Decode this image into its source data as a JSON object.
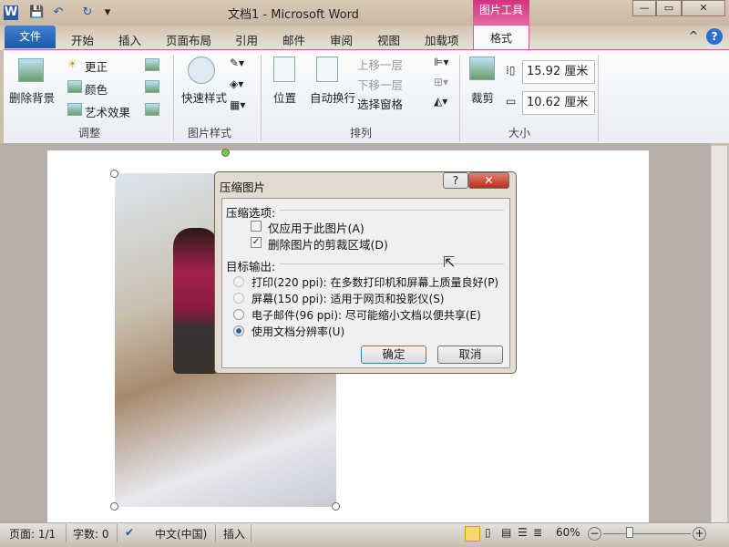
{
  "window": {
    "title": "文档1  -  Microsoft Word",
    "context_tab": "图片工具",
    "minimize": "—",
    "restore": "▭",
    "close": "✕"
  },
  "quick_access": {
    "word": "W",
    "save": "💾",
    "undo": "↶",
    "redo": "↻",
    "customize": "▾"
  },
  "tabs": {
    "file": "文件",
    "items": [
      "开始",
      "插入",
      "页面布局",
      "引用",
      "邮件",
      "审阅",
      "视图",
      "加载项"
    ],
    "format": "格式",
    "collapse": "^",
    "help": "?"
  },
  "ribbon": {
    "adjust": {
      "label": "调整",
      "remove_bg": "删除背景",
      "corrections": "更正",
      "color": "颜色",
      "artistic": "艺术效果"
    },
    "styles": {
      "label": "图片样式",
      "quick_styles": "快速样式"
    },
    "arrange": {
      "label": "排列",
      "position": "位置",
      "wrap": "自动换行",
      "bring_forward": "上移一层",
      "send_backward": "下移一层",
      "selection_pane": "选择窗格"
    },
    "size": {
      "label": "大小",
      "crop": "裁剪",
      "height": "15.92 厘米",
      "width": "10.62 厘米"
    }
  },
  "dialog": {
    "title": "压缩图片",
    "help": "?",
    "close": "✕",
    "section1": "压缩选项:",
    "options": [
      {
        "label": "仅应用于此图片(A)",
        "checked": false
      },
      {
        "label": "删除图片的剪裁区域(D)",
        "checked": true
      }
    ],
    "section2": "目标输出:",
    "radios": [
      {
        "label": "打印(220 ppi): 在多数打印机和屏幕上质量良好(P)",
        "enabled": false,
        "selected": false
      },
      {
        "label": "屏幕(150 ppi): 适用于网页和投影仪(S)",
        "enabled": false,
        "selected": false
      },
      {
        "label": "电子邮件(96 ppi): 尽可能缩小文档以便共享(E)",
        "enabled": true,
        "selected": false
      },
      {
        "label": "使用文档分辨率(U)",
        "enabled": true,
        "selected": true
      }
    ],
    "ok": "确定",
    "cancel": "取消"
  },
  "status": {
    "page": "页面: 1/1",
    "words": "字数: 0",
    "language": "中文(中国)",
    "mode": "插入",
    "zoom": "60%",
    "zoom_fraction": 0.6,
    "minus": "−",
    "plus": "+"
  }
}
